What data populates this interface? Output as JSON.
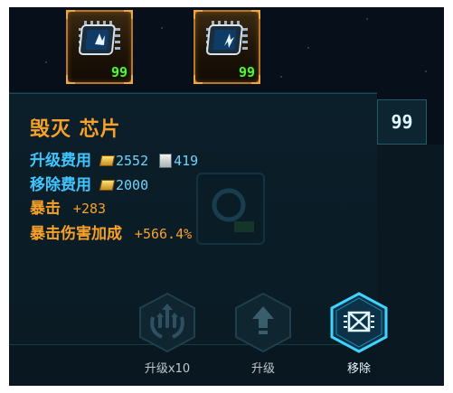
{
  "slots": [
    {
      "count": "99",
      "icon": "cpu-chip-icon"
    },
    {
      "count": "99",
      "icon": "cpu-chip-icon"
    }
  ],
  "item": {
    "name": "毁灭 芯片",
    "level": "99",
    "upgrade_cost_label": "升级费用",
    "upgrade_cost_gold": "2552",
    "upgrade_cost_scroll": "419",
    "remove_cost_label": "移除费用",
    "remove_cost_gold": "2000",
    "crit_label": "暴击",
    "crit_value": "+283",
    "crit_dmg_label": "暴击伤害加成",
    "crit_dmg_value": "+566.4%"
  },
  "actions": [
    {
      "label": "升级x10",
      "icon": "upgrade-x10-icon"
    },
    {
      "label": "升级",
      "icon": "upgrade-arrow-icon"
    },
    {
      "label": "移除",
      "icon": "remove-chip-icon"
    }
  ],
  "colors": {
    "accent_orange": "#f7a12a",
    "accent_blue": "#3fc6ff",
    "count_green": "#5cf03a",
    "active_cyan": "#3fd4ff"
  }
}
